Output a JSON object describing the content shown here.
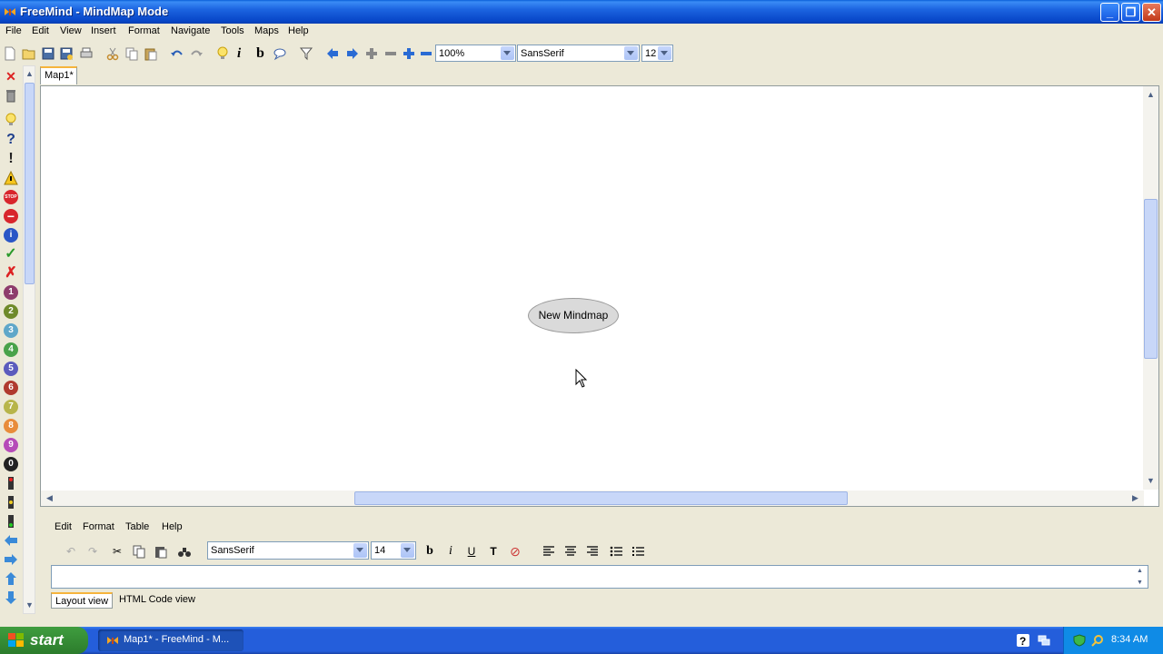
{
  "window": {
    "title": "FreeMind - MindMap Mode"
  },
  "menubar": [
    "File",
    "Edit",
    "View",
    "Insert",
    "Format",
    "Navigate",
    "Tools",
    "Maps",
    "Help"
  ],
  "toolbar": {
    "zoom": "100%",
    "font": "SansSerif",
    "size": "12"
  },
  "tabs": [
    "Map1*"
  ],
  "map": {
    "root_node": "New Mindmap"
  },
  "left_icons": [
    "close-icon",
    "trash-icon",
    "idea-icon",
    "question-icon",
    "important-icon",
    "warning-icon",
    "stop-icon",
    "stop-sign-icon",
    "info-icon",
    "checkmark-icon",
    "cancel-icon",
    "priority-1-icon",
    "priority-2-icon",
    "priority-3-icon",
    "priority-4-icon",
    "priority-5-icon",
    "priority-6-icon",
    "priority-7-icon",
    "priority-8-icon",
    "priority-9-icon",
    "priority-0-icon",
    "traffic-light-red-icon",
    "traffic-light-yellow-icon",
    "traffic-light-green-icon",
    "arrow-left-icon",
    "arrow-right-icon",
    "arrow-up-icon",
    "arrow-down-icon"
  ],
  "note_panel": {
    "menu": [
      "Edit",
      "Format",
      "Table",
      "Help"
    ],
    "font": "SansSerif",
    "size": "14",
    "tabs": [
      "Layout view",
      "HTML Code view"
    ]
  },
  "taskbar": {
    "start": "start",
    "task": "Map1* - FreeMind - M...",
    "time": "8:34 AM"
  }
}
